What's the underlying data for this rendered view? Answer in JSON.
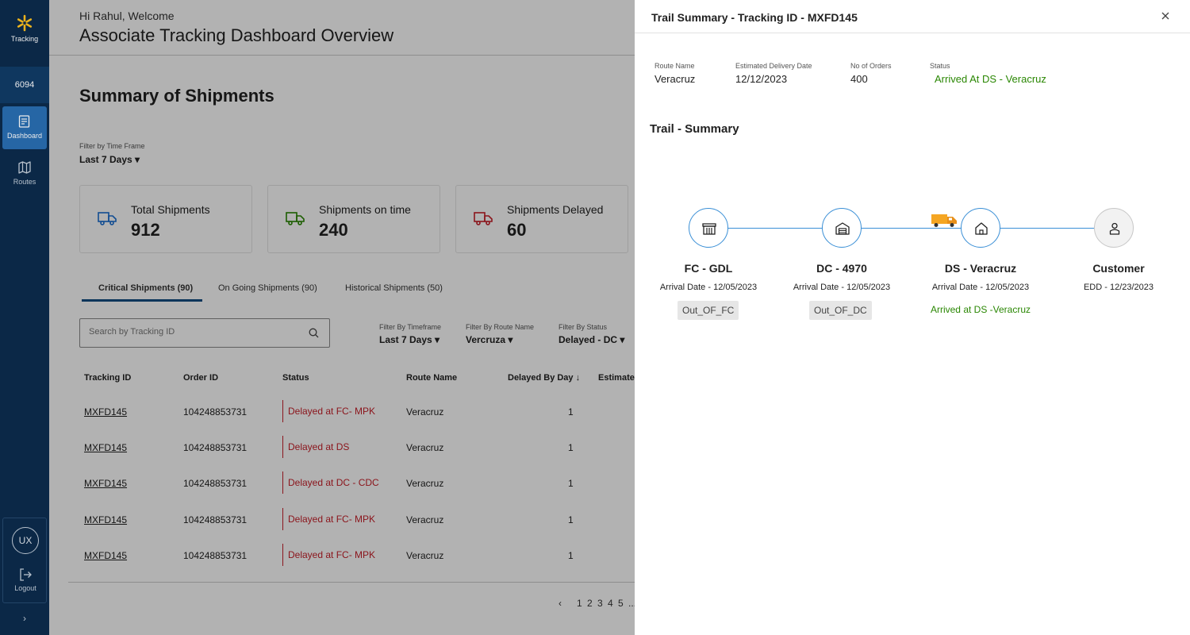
{
  "sidebar": {
    "logo_label": "Tracking",
    "store_number": "6094",
    "items": [
      {
        "label": "Dashboard",
        "icon": "dashboard-icon",
        "active": true
      },
      {
        "label": "Routes",
        "icon": "map-icon",
        "active": false
      }
    ],
    "user_initials": "UX",
    "logout_label": "Logout",
    "expand_icon": "chevron-right-icon"
  },
  "header": {
    "greeting": "Hi Rahul, Welcome",
    "title": "Associate Tracking Dashboard Overview"
  },
  "summary": {
    "title": "Summary of Shipments",
    "timeframe_label": "Filter by  Time Frame",
    "timeframe_value": "Last 7 Days",
    "cards": [
      {
        "label": "Total Shipments",
        "value": "912",
        "icon_color": "#1a6fd1"
      },
      {
        "label": "Shipments on time",
        "value": "240",
        "icon_color": "#2a8703"
      },
      {
        "label": "Shipments Delayed",
        "value": "60",
        "icon_color": "#c8202a"
      }
    ]
  },
  "tabs": [
    {
      "label": "Critical Shipments (90)",
      "active": true
    },
    {
      "label": "On Going Shipments  (90)",
      "active": false
    },
    {
      "label": "Historical Shipments (50)",
      "active": false
    }
  ],
  "search": {
    "placeholder": "Search by Tracking ID"
  },
  "filters": [
    {
      "label": "Filter By Timeframe",
      "value": "Last 7 Days"
    },
    {
      "label": "Filter By Route Name",
      "value": "Vercruza"
    },
    {
      "label": "Filter By Status",
      "value": "Delayed - DC"
    }
  ],
  "table": {
    "columns": [
      "Tracking ID",
      "Order ID",
      "Status",
      "Route Name",
      "Delayed By Day",
      "Estimated"
    ],
    "rows": [
      {
        "tracking_id": "MXFD145",
        "order_id": "104248853731",
        "status": "Delayed at FC- MPK",
        "route": "Veracruz",
        "delay": "1"
      },
      {
        "tracking_id": "MXFD145",
        "order_id": "104248853731",
        "status": "Delayed at DS",
        "route": "Veracruz",
        "delay": "1"
      },
      {
        "tracking_id": "MXFD145",
        "order_id": "104248853731",
        "status": "Delayed at DC - CDC",
        "route": "Veracruz",
        "delay": "1"
      },
      {
        "tracking_id": "MXFD145",
        "order_id": "104248853731",
        "status": "Delayed at FC- MPK",
        "route": "Veracruz",
        "delay": "1"
      },
      {
        "tracking_id": "MXFD145",
        "order_id": "104248853731",
        "status": "Delayed at FC- MPK",
        "route": "Veracruz",
        "delay": "1"
      }
    ]
  },
  "pagination": {
    "pages": [
      "1",
      "2",
      "3",
      "4",
      "5",
      "..."
    ]
  },
  "drawer": {
    "title": "Trail Summary - Tracking ID - MXFD145",
    "meta": [
      {
        "label": "Route Name",
        "value": "Veracruz"
      },
      {
        "label": "Estimated Delivery Date",
        "value": "12/12/2023"
      },
      {
        "label": "No of Orders",
        "value": "400"
      },
      {
        "label": "Status",
        "value": "Arrived At DS - Veracruz"
      }
    ],
    "trail_title": "Trail - Summary",
    "nodes": [
      {
        "name": "FC - GDL",
        "date": "Arrival Date   - 12/05/2023",
        "badge": "Out_OF_FC",
        "icon": "store-icon"
      },
      {
        "name": "DC - 4970",
        "date": "Arrival Date   - 12/05/2023",
        "badge": "Out_OF_DC",
        "icon": "warehouse-icon"
      },
      {
        "name": "DS - Veracruz",
        "date": "Arrival Date - 12/05/2023",
        "status": "Arrived at DS -Veracruz",
        "icon": "home-icon"
      },
      {
        "name": "Customer",
        "date": "EDD - 12/23/2023",
        "icon": "person-icon"
      }
    ],
    "truck_icon": "truck-icon"
  }
}
